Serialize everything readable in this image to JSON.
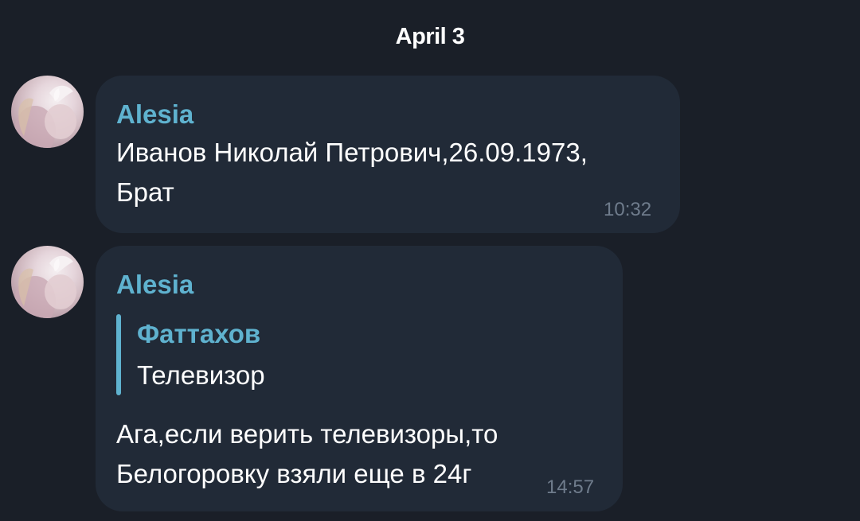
{
  "date_separator": "April 3",
  "messages": [
    {
      "sender": "Alesia",
      "text_lines": [
        "Иванов Николай Петрович,26.09.1973,",
        "Брат"
      ],
      "time": "10:32"
    },
    {
      "sender": "Alesia",
      "reply": {
        "name": "Фаттахов",
        "text": "Телевизор"
      },
      "text_lines": [
        "Ага,если верить телевизоры,то",
        "Белогоровку взяли еще в 24г"
      ],
      "time": "14:57"
    }
  ],
  "colors": {
    "background": "#1a1f28",
    "bubble": "#212a37",
    "accent": "#5fb2cf",
    "time": "#6f7c8c"
  },
  "icons": {
    "avatar": "user-avatar-photo"
  }
}
